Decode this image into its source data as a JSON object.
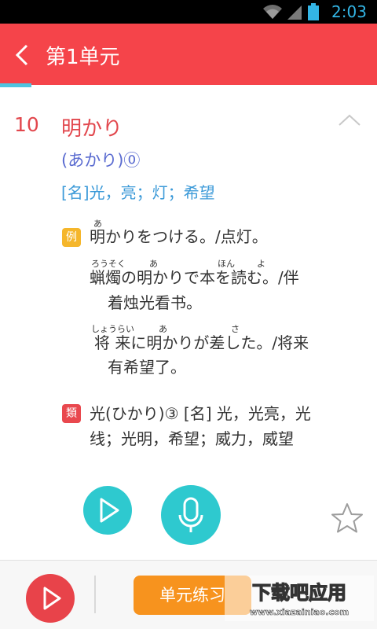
{
  "status": {
    "time": "2:03"
  },
  "header": {
    "title": "第1单元"
  },
  "entry": {
    "number": "10",
    "word": "明かり",
    "reading": "(あかり)⓪",
    "meaning": "[名]光，亮；灯；希望"
  },
  "example": {
    "tag": "例",
    "sentences": [
      {
        "ruby": [
          "あ"
        ],
        "line1": "明かりをつける。/点灯。",
        "line2": ""
      },
      {
        "ruby": [
          "ろうそく",
          "あ",
          "ほん",
          "よ"
        ],
        "line1": "蝋燭の明かりで本を読む。/伴",
        "line2": "着烛光看书。"
      },
      {
        "ruby": [
          "しょうらい",
          "あ",
          "さ"
        ],
        "line1": "将 来に明かりが差した。/将来",
        "line2": "有希望了。"
      }
    ]
  },
  "similar": {
    "tag": "類",
    "text": "光(ひかり)③ [名] 光，光亮，光线；光明，希望；威力，威望"
  },
  "bottom": {
    "practice_label": "单元练习",
    "watermark_main": "下载吧应用",
    "watermark_url": "www.xiazainiao.com"
  }
}
